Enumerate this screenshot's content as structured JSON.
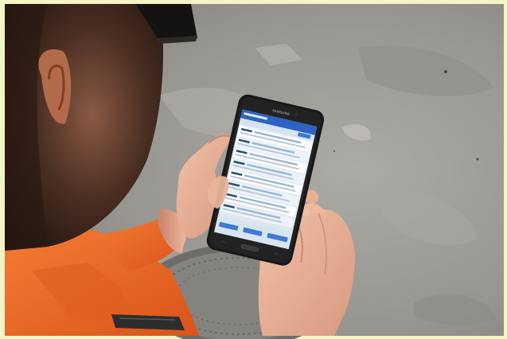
{
  "photo": {
    "device_brand": "SAMSUNG"
  },
  "colors": {
    "frame": "#f4f4c4",
    "pavement": "#9c9a94",
    "shirt": "#ee6a26",
    "skin": "#e7aa8c",
    "tablet_body": "#171717",
    "app_header": "#2c63c3",
    "app_bg": "#e8f0f6",
    "app_button": "#3b7ad8"
  },
  "icons": [
    "tablet-device",
    "app-screen"
  ]
}
